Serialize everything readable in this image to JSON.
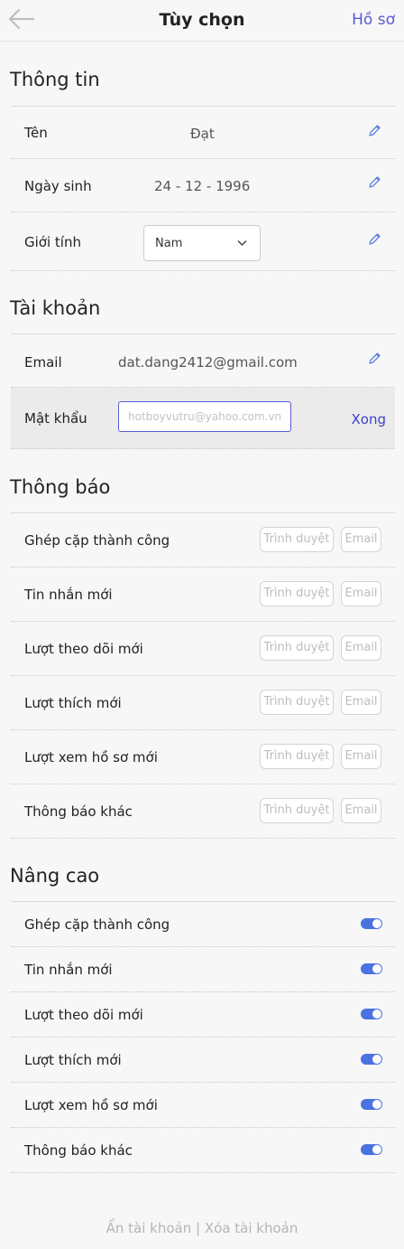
{
  "header": {
    "title": "Tùy chọn",
    "profile_link": "Hồ sơ"
  },
  "info": {
    "title": "Thông tin",
    "name_label": "Tên",
    "name_value": "Đạt",
    "dob_label": "Ngày sinh",
    "dob_value": "24 - 12 - 1996",
    "gender_label": "Giới tính",
    "gender_value": "Nam"
  },
  "account": {
    "title": "Tài khoản",
    "email_label": "Email",
    "email_value": "dat.dang2412@gmail.com",
    "password_label": "Mật khẩu",
    "password_placeholder": "hotboyvutru@yahoo.com.vn",
    "done_label": "Xong"
  },
  "notifications": {
    "title": "Thông báo",
    "browser_label": "Trình duyệt",
    "email_label": "Email",
    "items": [
      {
        "label": "Ghép cặp thành công"
      },
      {
        "label": "Tin nhắn mới"
      },
      {
        "label": "Lượt theo dõi mới"
      },
      {
        "label": "Lượt thích mới"
      },
      {
        "label": "Lượt xem hồ sơ mới"
      },
      {
        "label": "Thông báo khác"
      }
    ]
  },
  "advanced": {
    "title": "Nâng cao",
    "items": [
      {
        "label": "Ghép cặp thành công",
        "enabled": true
      },
      {
        "label": "Tin nhắn mới",
        "enabled": true
      },
      {
        "label": "Lượt theo dõi mới",
        "enabled": true
      },
      {
        "label": "Lượt thích mới",
        "enabled": true
      },
      {
        "label": "Lượt xem hồ sơ mới",
        "enabled": true
      },
      {
        "label": "Thông báo khác",
        "enabled": true
      }
    ]
  },
  "footer": {
    "hide_account": "Ẩn tài khoản",
    "separator": " | ",
    "delete_account": "Xóa tài khoản"
  },
  "colors": {
    "accent": "#5a5ad6",
    "toggle_on": "#4a72e0"
  }
}
